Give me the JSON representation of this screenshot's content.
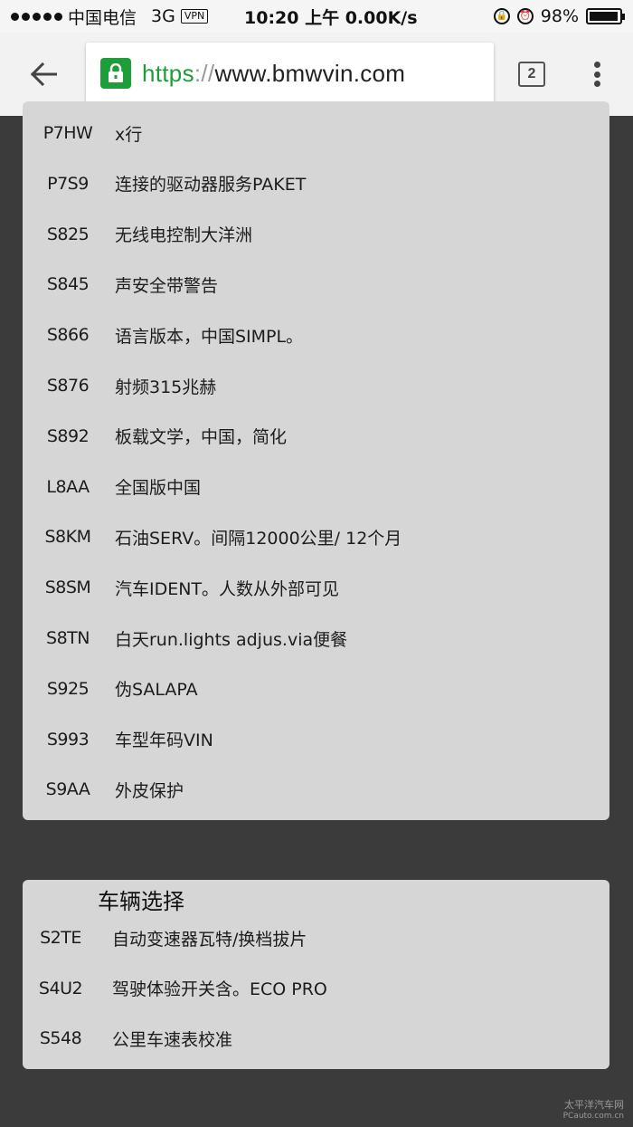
{
  "status_bar": {
    "carrier": "中国电信",
    "network": "3G",
    "vpn": "VPN",
    "time_speed": "10:20 上午 0.00K/s",
    "battery": "98%",
    "battery_level": 0.98
  },
  "browser": {
    "url_scheme": "https",
    "url_sep": "://",
    "url_host": "www.bmwvin.com",
    "tab_count": "2"
  },
  "options": [
    {
      "code": "P7HW",
      "desc": "x行"
    },
    {
      "code": "P7S9",
      "desc": "连接的驱动器服务PAKET"
    },
    {
      "code": "S825",
      "desc": "无线电控制大洋洲"
    },
    {
      "code": "S845",
      "desc": "声安全带警告"
    },
    {
      "code": "S866",
      "desc": "语言版本，中国SIMPL。"
    },
    {
      "code": "S876",
      "desc": "射频315兆赫"
    },
    {
      "code": "S892",
      "desc": "板载文学，中国，简化"
    },
    {
      "code": "L8AA",
      "desc": "全国版中国"
    },
    {
      "code": "S8KM",
      "desc": "石油SERV。间隔12000公里/ 12个月"
    },
    {
      "code": "S8SM",
      "desc": "汽车IDENT。人数从外部可见"
    },
    {
      "code": "S8TN",
      "desc": "白天run.lights adjus.via便餐"
    },
    {
      "code": "S925",
      "desc": "伪SALAPA"
    },
    {
      "code": "S993",
      "desc": "车型年码VIN"
    },
    {
      "code": "S9AA",
      "desc": "外皮保护"
    }
  ],
  "vehicle_selection": {
    "title": "车辆选择",
    "items": [
      {
        "code": "S2TE",
        "desc": "自动变速器瓦特/换档拔片"
      },
      {
        "code": "S4U2",
        "desc": "驾驶体验开关含。ECO PRO"
      },
      {
        "code": "S548",
        "desc": "公里车速表校准"
      }
    ]
  },
  "watermark": {
    "line1": "太平洋汽车网",
    "line2": "PCauto.com.cn"
  }
}
